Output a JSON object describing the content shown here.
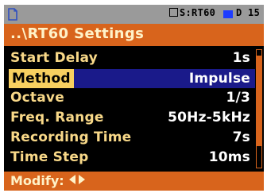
{
  "status": {
    "mode_text": "S:RT60",
    "page_text": "D 15"
  },
  "title": "..\\RT60 Settings",
  "settings": [
    {
      "label": "Start Delay",
      "value": "1s"
    },
    {
      "label": "Method",
      "value": "Impulse",
      "selected": true
    },
    {
      "label": "Octave",
      "value": "1/3"
    },
    {
      "label": "Freq. Range",
      "value": "50Hz-5kHz"
    },
    {
      "label": "Recording Time",
      "value": "7s"
    },
    {
      "label": "Time Step",
      "value": "10ms"
    }
  ],
  "footer": {
    "label": "Modify:"
  },
  "colors": {
    "accent": "#d8641c",
    "label": "#f8d888",
    "selection": "#f8d060",
    "value_highlight": "#1a1a8a"
  }
}
